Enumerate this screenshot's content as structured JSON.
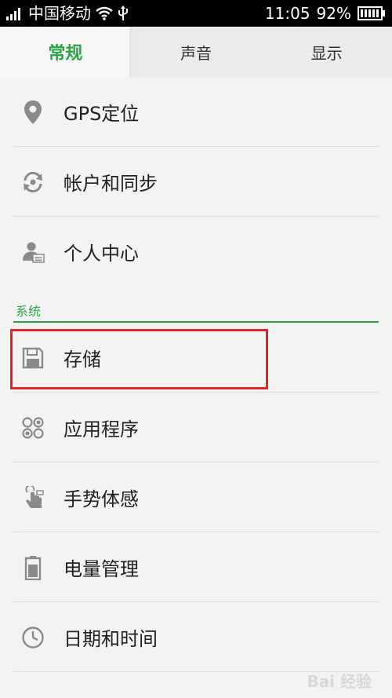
{
  "status_bar": {
    "carrier": "中国移动",
    "time": "11:05",
    "battery": "92%"
  },
  "tabs": [
    {
      "label": "常规",
      "active": true
    },
    {
      "label": "声音",
      "active": false
    },
    {
      "label": "显示",
      "active": false
    }
  ],
  "items_top": [
    {
      "label": "GPS定位",
      "icon": "location-pin-icon"
    },
    {
      "label": "帐户和同步",
      "icon": "sync-icon"
    },
    {
      "label": "个人中心",
      "icon": "personal-center-icon"
    }
  ],
  "section": {
    "label": "系统"
  },
  "items_system": [
    {
      "label": "存储",
      "icon": "floppy-disk-icon"
    },
    {
      "label": "应用程序",
      "icon": "apps-icon"
    },
    {
      "label": "手势体感",
      "icon": "gesture-icon"
    },
    {
      "label": "电量管理",
      "icon": "battery-icon"
    },
    {
      "label": "日期和时间",
      "icon": "clock-icon"
    }
  ],
  "watermark": "Bai 经验",
  "colors": {
    "accent": "#2aa44a",
    "highlight": "#e3242b",
    "icon": "#8a8a8a"
  }
}
